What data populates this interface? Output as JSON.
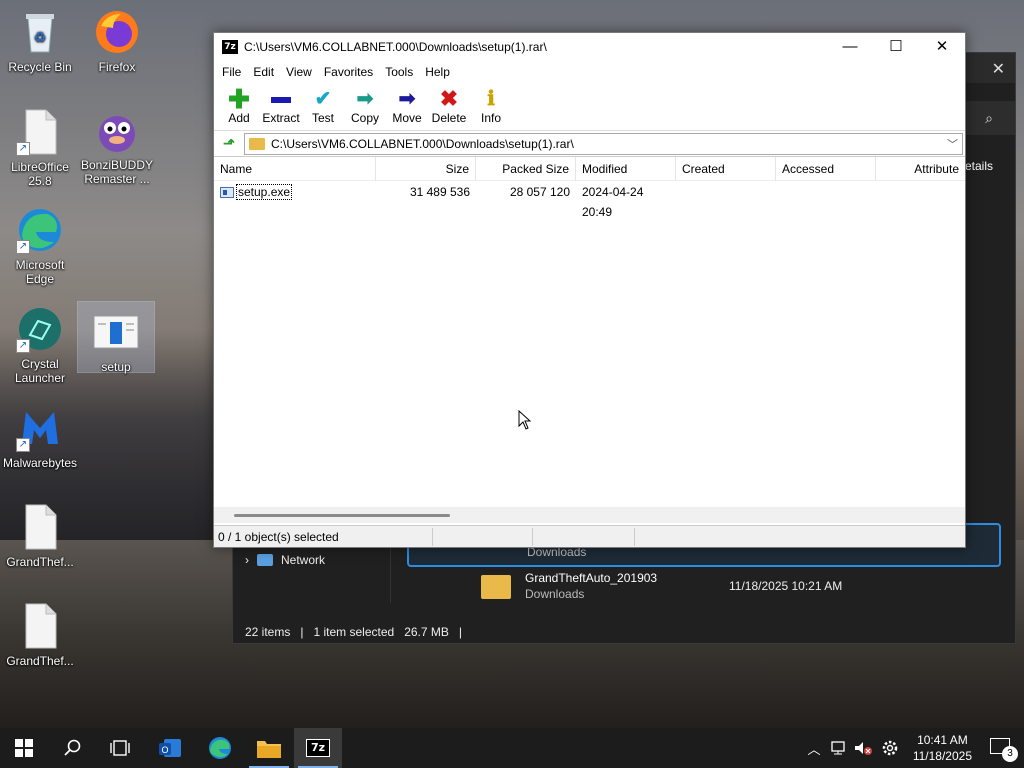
{
  "desktop": {
    "icons": [
      {
        "label": "Recycle Bin"
      },
      {
        "label": "Firefox"
      },
      {
        "label": "LibreOffice 25.8"
      },
      {
        "label": "BonziBUDDY Remaster ..."
      },
      {
        "label": "Microsoft Edge"
      },
      {
        "label": "Crystal Launcher"
      },
      {
        "label": "setup"
      },
      {
        "label": "Malwarebytes"
      },
      {
        "label": "GrandThef..."
      },
      {
        "label": "GrandThef..."
      }
    ]
  },
  "explorer": {
    "details_label": "etails",
    "nav_network": "Network",
    "rows": [
      {
        "loc": "Downloads"
      },
      {
        "name": "GrandTheftAuto_201903",
        "loc": "Downloads",
        "date": "11/18/2025 10:21 AM"
      }
    ],
    "status": {
      "items": "22 items",
      "selected": "1 item selected",
      "size": "26.7 MB"
    }
  },
  "sevenzip": {
    "title": "C:\\Users\\VM6.COLLABNET.000\\Downloads\\setup(1).rar\\",
    "badge": "7z",
    "menu": [
      "File",
      "Edit",
      "View",
      "Favorites",
      "Tools",
      "Help"
    ],
    "toolbar": {
      "add": "Add",
      "extract": "Extract",
      "test": "Test",
      "copy": "Copy",
      "move": "Move",
      "delete": "Delete",
      "info": "Info"
    },
    "address": "C:\\Users\\VM6.COLLABNET.000\\Downloads\\setup(1).rar\\",
    "columns": {
      "name": "Name",
      "size": "Size",
      "packed": "Packed Size",
      "modified": "Modified",
      "created": "Created",
      "accessed": "Accessed",
      "attributes": "Attribute"
    },
    "files": [
      {
        "name": "setup.exe",
        "size": "31 489 536",
        "packed": "28 057 120",
        "modified": "2024-04-24 20:49"
      }
    ],
    "status": "0 / 1 object(s) selected"
  },
  "taskbar": {
    "time": "10:41 AM",
    "date": "11/18/2025",
    "notifications": "3",
    "app_7z": "7z"
  }
}
